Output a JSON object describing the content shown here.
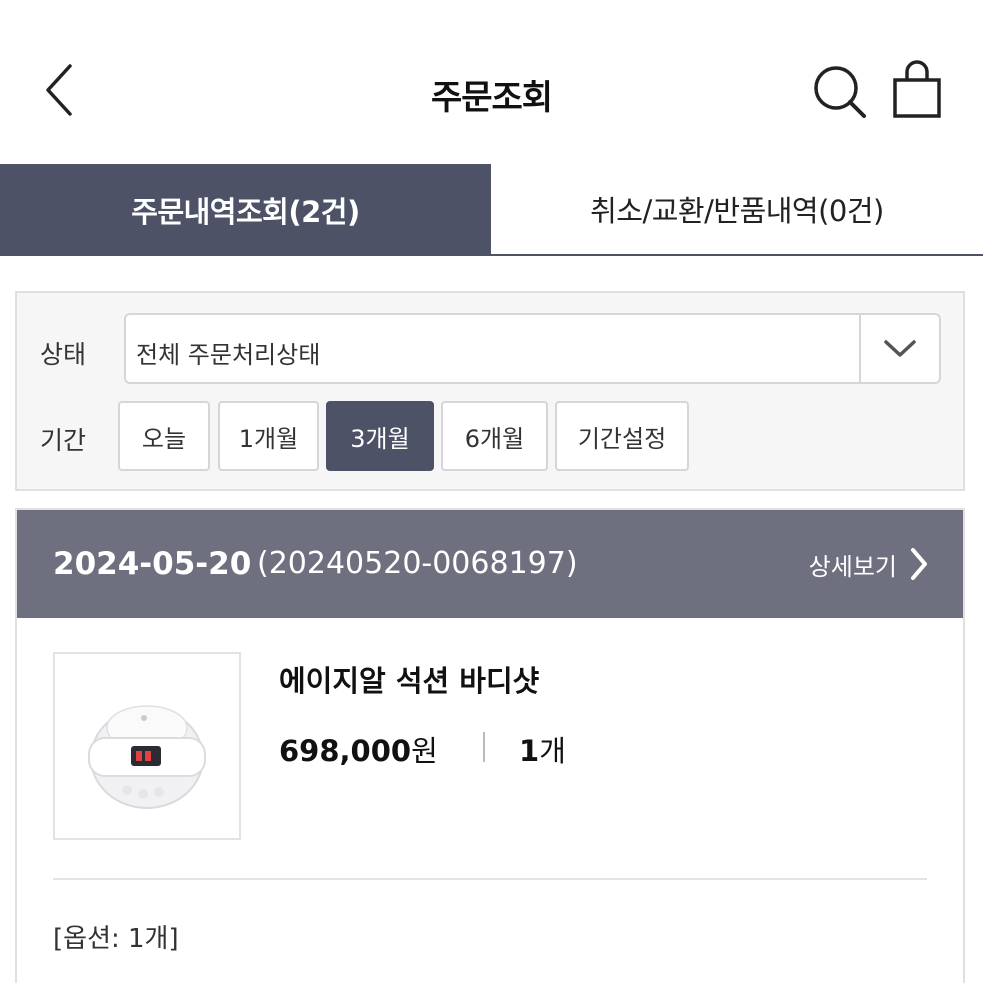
{
  "header": {
    "title": "주문조회",
    "back_icon": "chevron-left-icon",
    "search_icon": "search-icon",
    "bag_icon": "shopping-bag-icon"
  },
  "tabs": [
    {
      "label": "주문내역조회(2건)",
      "active": true
    },
    {
      "label": "취소/교환/반품내역(0건)",
      "active": false
    }
  ],
  "filter": {
    "status_label": "상태",
    "status_value": "전체 주문처리상태",
    "period_label": "기간",
    "period_options": [
      "오늘",
      "1개월",
      "3개월",
      "6개월",
      "기간설정"
    ],
    "selected_period": "3개월"
  },
  "order": {
    "date": "2024-05-20",
    "number": "(20240520-0068197)",
    "detail_label": "상세보기",
    "product": {
      "name": "에이지알 석션 바디샷",
      "price": "698,000",
      "price_unit": "원",
      "quantity": "1",
      "quantity_unit": "개",
      "option": "[옵션: 1개]"
    }
  },
  "colors": {
    "accent": "#4d5266",
    "order_header_bg": "#6e7080",
    "filter_bg": "#f6f6f7"
  }
}
